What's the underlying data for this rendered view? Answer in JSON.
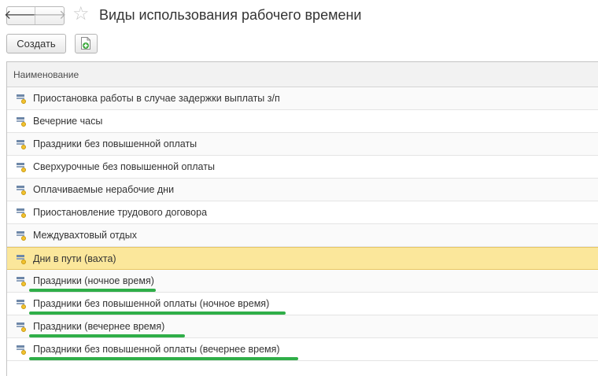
{
  "window": {
    "title": "Виды использования рабочего времени"
  },
  "toolbar": {
    "back_icon": "arrow-left-icon",
    "forward_icon": "arrow-right-icon",
    "favorite_icon": "star-icon",
    "create_label": "Создать",
    "add_icon": "add-document-icon"
  },
  "table": {
    "columns": [
      "Наименование"
    ],
    "rows": [
      {
        "name": "Приостановка работы в случае задержки выплаты з/п",
        "selected": false,
        "highlighted": false
      },
      {
        "name": "Вечерние часы",
        "selected": false,
        "highlighted": false
      },
      {
        "name": "Праздники без повышенной оплаты",
        "selected": false,
        "highlighted": false
      },
      {
        "name": "Сверхурочные без повышенной оплаты",
        "selected": false,
        "highlighted": false
      },
      {
        "name": "Оплачиваемые нерабочие дни",
        "selected": false,
        "highlighted": false
      },
      {
        "name": "Приостановление трудового договора",
        "selected": false,
        "highlighted": false
      },
      {
        "name": "Междувахтовый отдых",
        "selected": false,
        "highlighted": false
      },
      {
        "name": "Дни в пути (вахта)",
        "selected": true,
        "highlighted": false
      },
      {
        "name": "Праздники (ночное время)",
        "selected": false,
        "highlighted": true
      },
      {
        "name": "Праздники без повышенной оплаты (ночное время)",
        "selected": false,
        "highlighted": true
      },
      {
        "name": "Праздники (вечернее время)",
        "selected": false,
        "highlighted": true
      },
      {
        "name": "Праздники без повышенной оплаты (вечернее время)",
        "selected": false,
        "highlighted": true
      }
    ]
  },
  "colors": {
    "selection": "#fbe79b",
    "highlight_underline": "#2fae48"
  }
}
